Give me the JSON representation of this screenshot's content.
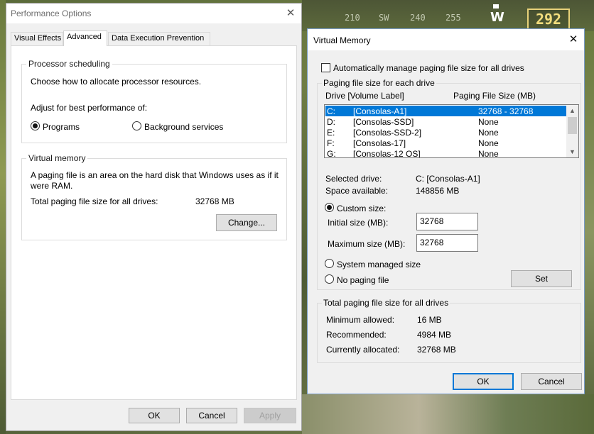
{
  "background": {
    "hud_ticks": [
      "210",
      "SW",
      "240",
      "255"
    ],
    "hud_heading": "W",
    "hud_value": "292"
  },
  "perf_window": {
    "title": "Performance Options",
    "tabs": [
      "Visual Effects",
      "Advanced",
      "Data Execution Prevention"
    ],
    "active_tab": "Advanced",
    "processor_scheduling": {
      "legend": "Processor scheduling",
      "description": "Choose how to allocate processor resources.",
      "adjust_label": "Adjust for best performance of:",
      "option_programs": "Programs",
      "option_background": "Background services",
      "selected": "Programs"
    },
    "virtual_memory": {
      "legend": "Virtual memory",
      "description_line1": "A paging file is an area on the hard disk that Windows uses as if it",
      "description_line2": "were RAM.",
      "total_label": "Total paging file size for all drives:",
      "total_value": "32768 MB",
      "change_button": "Change..."
    },
    "buttons": {
      "ok": "OK",
      "cancel": "Cancel",
      "apply": "Apply"
    }
  },
  "vm_window": {
    "title": "Virtual Memory",
    "auto_manage_label": "Automatically manage paging file size for all drives",
    "auto_manage_checked": false,
    "paging_group": {
      "legend": "Paging file size for each drive",
      "col_drive": "Drive  [Volume Label]",
      "col_size": "Paging File Size (MB)",
      "rows": [
        {
          "drive": "C:",
          "label": "[Consolas-A1]",
          "size": "32768 - 32768",
          "selected": true
        },
        {
          "drive": "D:",
          "label": "[Consolas-SSD]",
          "size": "None",
          "selected": false
        },
        {
          "drive": "E:",
          "label": "[Consolas-SSD-2]",
          "size": "None",
          "selected": false
        },
        {
          "drive": "F:",
          "label": "[Consolas-17]",
          "size": "None",
          "selected": false
        },
        {
          "drive": "G:",
          "label": "[Consolas-12 OS]",
          "size": "None",
          "selected": false
        }
      ],
      "selected_drive_label": "Selected drive:",
      "selected_drive_value": "C:  [Consolas-A1]",
      "space_available_label": "Space available:",
      "space_available_value": "148856 MB",
      "custom_size_label": "Custom size:",
      "initial_size_label": "Initial size (MB):",
      "initial_size_value": "32768",
      "maximum_size_label": "Maximum size (MB):",
      "maximum_size_value": "32768",
      "system_managed_label": "System managed size",
      "no_paging_label": "No paging file",
      "set_button": "Set",
      "selected_option": "Custom size"
    },
    "total_group": {
      "legend": "Total paging file size for all drives",
      "min_label": "Minimum allowed:",
      "min_value": "16 MB",
      "recommended_label": "Recommended:",
      "recommended_value": "4984 MB",
      "allocated_label": "Currently allocated:",
      "allocated_value": "32768 MB"
    },
    "buttons": {
      "ok": "OK",
      "cancel": "Cancel"
    }
  },
  "colors": {
    "selection": "#0078d7",
    "dialog_bg": "#f0f0f0",
    "hud_accent": "#e8d27a"
  }
}
